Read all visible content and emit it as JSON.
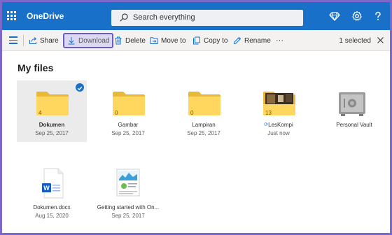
{
  "appbar": {
    "app_title": "OneDrive",
    "search_placeholder": "Search everything",
    "icons": [
      "waffle-icon",
      "diamond-icon",
      "gear-icon",
      "help-icon"
    ]
  },
  "commandbar": {
    "share": "Share",
    "download": "Download",
    "delete": "Delete",
    "move_to": "Move to",
    "copy_to": "Copy to",
    "rename": "Rename",
    "more": "···",
    "selection_count": "1 selected"
  },
  "main": {
    "heading": "My files",
    "items": [
      {
        "name": "Dokumen",
        "date": "Sep 25, 2017",
        "type": "folder",
        "count": "4",
        "selected": true
      },
      {
        "name": "Gambar",
        "date": "Sep 25, 2017",
        "type": "folder",
        "count": "0",
        "selected": false
      },
      {
        "name": "Lampiran",
        "date": "Sep 25, 2017",
        "type": "folder",
        "count": "0",
        "selected": false
      },
      {
        "name": "LesKompi",
        "date": "Just now",
        "type": "folder-photo",
        "count": "13",
        "selected": false
      },
      {
        "name": "Personal Vault",
        "date": "",
        "type": "vault",
        "count": "",
        "selected": false
      },
      {
        "name": "Dokumen.docx",
        "date": "Aug 15, 2020",
        "type": "word-doc",
        "count": "",
        "selected": false
      },
      {
        "name": "Getting started with On...",
        "date": "Sep 25, 2017",
        "type": "pdf-thumb",
        "count": "",
        "selected": false
      }
    ]
  },
  "colors": {
    "brand_blue": "#1970c8",
    "folder_yellow": "#ffd75e",
    "highlight_purple": "#6b5cc7"
  }
}
